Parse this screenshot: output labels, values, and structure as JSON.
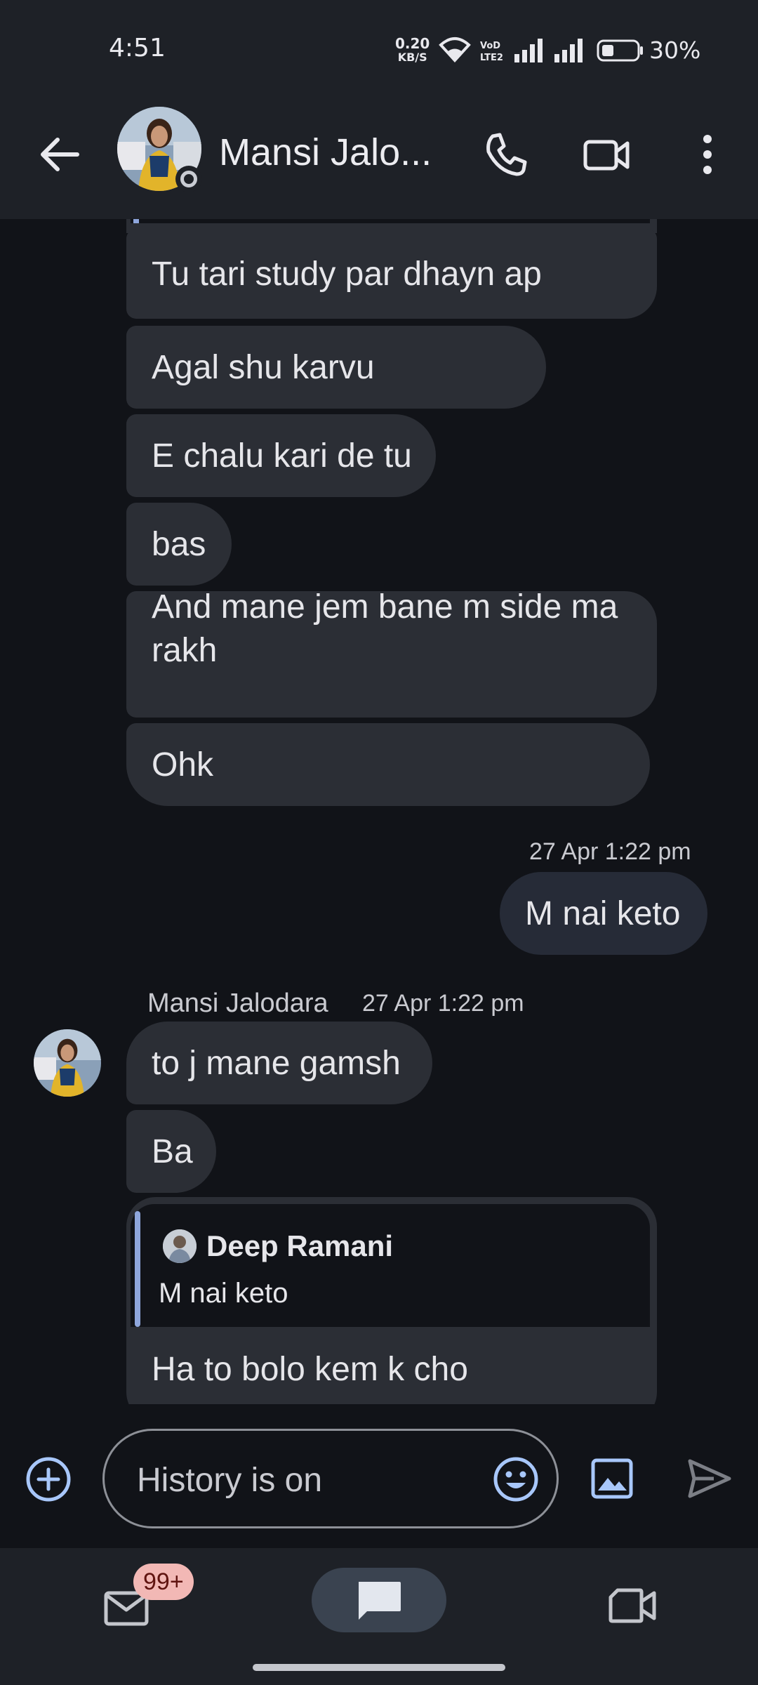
{
  "status_bar": {
    "time": "4:51",
    "net_speed_value": "0.20",
    "net_speed_unit": "KB/S",
    "battery_percent": "30%"
  },
  "app_bar": {
    "contact_name": "Mansi Jalo..."
  },
  "messages": [
    {
      "text": "Tu tari study par dhayn ap"
    },
    {
      "text": "Agal shu karvu"
    },
    {
      "text": "E chalu kari de tu"
    },
    {
      "text": "bas"
    },
    {
      "text_line1": "And mane jem bane m side ma",
      "text_line2": "rakh"
    },
    {
      "text": "Ohk"
    },
    {
      "timestamp": "27 Apr 1:22 pm",
      "text": "M nai keto"
    },
    {
      "sender": "Mansi Jalodara",
      "timestamp": "27 Apr 1:22 pm",
      "text": "to j mane gamsh"
    },
    {
      "text": "Ba"
    },
    {
      "reply_author": "Deep Ramani",
      "reply_quote": "M nai keto",
      "text": "Ha to bolo kem k cho"
    }
  ],
  "composer": {
    "placeholder": "History is on"
  },
  "bottom_nav": {
    "mail_badge": "99+"
  },
  "colors": {
    "background": "#111318",
    "bar": "#1e2127",
    "bubble": "#2b2e35",
    "accent": "#a8c7fa",
    "badge": "#f2b8b5"
  }
}
